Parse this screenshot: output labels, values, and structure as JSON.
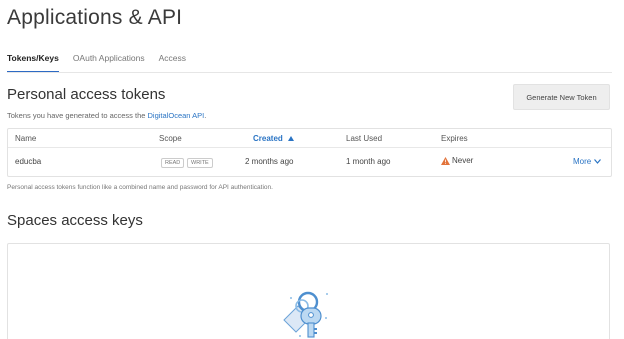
{
  "page": {
    "title": "Applications & API"
  },
  "tabs": [
    {
      "label": "Tokens/Keys",
      "active": true
    },
    {
      "label": "OAuth Applications",
      "active": false
    },
    {
      "label": "Access",
      "active": false
    }
  ],
  "personal_tokens": {
    "title": "Personal access tokens",
    "subtitle_prefix": "Tokens you have generated to access the ",
    "subtitle_link": "DigitalOcean API",
    "subtitle_suffix": ".",
    "generate_button": "Generate New Token",
    "columns": {
      "name": "Name",
      "scope": "Scope",
      "created": "Created",
      "last_used": "Last Used",
      "expires": "Expires"
    },
    "rows": [
      {
        "name": "educba",
        "scopes": [
          "READ",
          "WRITE"
        ],
        "created": "2 months ago",
        "last_used": "1 month ago",
        "expires": "Never",
        "more": "More"
      }
    ],
    "note": "Personal access tokens function like a combined name and password for API authentication."
  },
  "spaces": {
    "title": "Spaces access keys"
  },
  "colors": {
    "accent": "#2a74c4",
    "warning": "#e2733b"
  },
  "icons": {
    "sort": "caret-up-icon",
    "warning": "warning-triangle-icon",
    "more": "chevron-down-icon",
    "keys": "keys-illustration"
  }
}
